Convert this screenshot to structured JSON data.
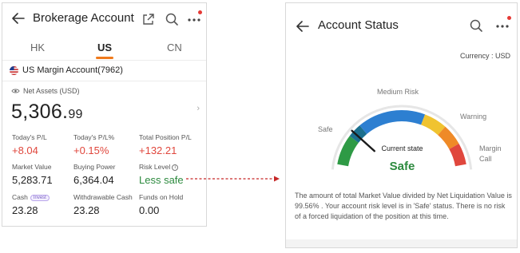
{
  "left": {
    "title": "Brokerage Account",
    "tabs": [
      "HK",
      "US",
      "CN"
    ],
    "active_tab": "US",
    "account_name": "US Margin Account(7962)",
    "net_assets_label": "Net Assets (USD)",
    "net_assets_int": "5,306.",
    "net_assets_dec": "99",
    "metrics": {
      "todays_pl_label": "Today's P/L",
      "todays_pl_value": "+8.04",
      "todays_pl_pct_label": "Today's P/L%",
      "todays_pl_pct_value": "+0.15%",
      "total_position_pl_label": "Total Position P/L",
      "total_position_pl_value": "+132.21",
      "market_value_label": "Market Value",
      "market_value_value": "5,283.71",
      "buying_power_label": "Buying Power",
      "buying_power_value": "6,364.04",
      "risk_level_label": "Risk Level",
      "risk_level_value": "Less safe",
      "cash_label": "Cash",
      "cash_badge": "Invest",
      "cash_value": "23.28",
      "withdrawable_cash_label": "Withdrawable Cash",
      "withdrawable_cash_value": "23.28",
      "funds_on_hold_label": "Funds on Hold",
      "funds_on_hold_value": "0.00"
    }
  },
  "right": {
    "title": "Account Status",
    "currency": "Currency : USD",
    "gauge": {
      "labels": {
        "safe": "Safe",
        "medium_risk": "Medium Risk",
        "warning": "Warning",
        "margin_call_1": "Margin",
        "margin_call_2": "Call"
      },
      "current_state_label": "Current state",
      "current_state_value": "Safe",
      "needle_fraction": 0.2
    },
    "description": "The amount of total Market Value divided by Net Liquidation Value is 99.56% . Your account risk level is in 'Safe' status. There is no risk of a forced liquidation of the position at this time."
  },
  "colors": {
    "accent": "#f07a1c",
    "negative": "#e0473d",
    "positive": "#2c8a3e",
    "notification": "#e53935",
    "connector": "#c62828"
  }
}
